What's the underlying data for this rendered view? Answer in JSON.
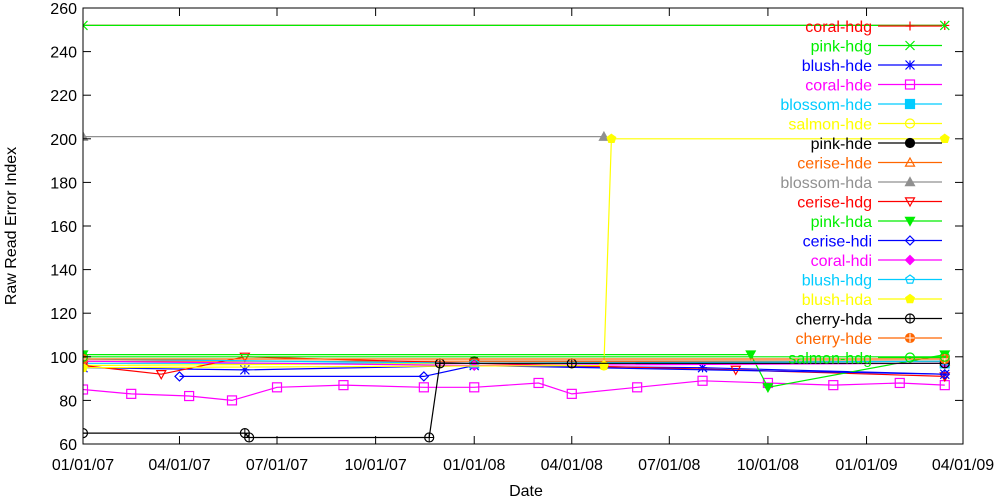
{
  "chart_data": {
    "type": "scatter",
    "title": "",
    "xlabel": "Date",
    "ylabel": "Raw Read Error Index",
    "ylim": [
      60,
      260
    ],
    "xlim": [
      "2007-01-01",
      "2009-04-01"
    ],
    "yticks": [
      60,
      80,
      100,
      120,
      140,
      160,
      180,
      200,
      220,
      240,
      260
    ],
    "xticks": [
      "01/01/07",
      "04/01/07",
      "07/01/07",
      "10/01/07",
      "01/01/08",
      "04/01/08",
      "07/01/08",
      "10/01/08",
      "01/01/09",
      "04/01/09"
    ],
    "xtick_dates": [
      "2007-01-01",
      "2007-04-01",
      "2007-07-01",
      "2007-10-01",
      "2008-01-01",
      "2008-04-01",
      "2008-07-01",
      "2008-10-01",
      "2009-01-01",
      "2009-04-01"
    ],
    "grid": false,
    "legend_position": "top-right",
    "series": [
      {
        "name": "coral-hdg",
        "color": "#ff0000",
        "marker": "plus",
        "x": [
          "2007-01-01",
          "2009-03-15"
        ],
        "y": [
          252,
          252
        ]
      },
      {
        "name": "pink-hdg",
        "color": "#00ee00",
        "marker": "x",
        "x": [
          "2007-01-01",
          "2009-03-15"
        ],
        "y": [
          252,
          252
        ]
      },
      {
        "name": "blush-hde",
        "color": "#0000ff",
        "marker": "star",
        "x": [
          "2007-01-01",
          "2007-06-01",
          "2008-01-01",
          "2008-08-01",
          "2009-03-15"
        ],
        "y": [
          95,
          94,
          96,
          95,
          92
        ]
      },
      {
        "name": "coral-hde",
        "color": "#ff00ff",
        "marker": "square-open",
        "x": [
          "2007-01-01",
          "2007-02-15",
          "2007-04-10",
          "2007-05-20",
          "2007-07-01",
          "2007-09-01",
          "2007-11-15",
          "2008-01-01",
          "2008-03-01",
          "2008-04-01",
          "2008-06-01",
          "2008-08-01",
          "2008-10-01",
          "2008-12-01",
          "2009-02-01",
          "2009-03-15"
        ],
        "y": [
          85,
          83,
          82,
          80,
          86,
          87,
          86,
          86,
          88,
          83,
          86,
          89,
          88,
          87,
          88,
          87
        ]
      },
      {
        "name": "blossom-hde",
        "color": "#00ccff",
        "marker": "square-filled",
        "x": [
          "2007-01-01",
          "2008-01-01",
          "2009-03-15"
        ],
        "y": [
          97,
          97,
          97
        ]
      },
      {
        "name": "salmon-hde",
        "color": "#ffff00",
        "marker": "circle-open",
        "x": [
          "2007-01-01",
          "2008-01-01",
          "2008-05-01"
        ],
        "y": [
          96,
          97,
          96
        ]
      },
      {
        "name": "pink-hde",
        "color": "#000000",
        "marker": "circle-filled",
        "x": [
          "2008-01-01",
          "2009-03-15"
        ],
        "y": [
          98,
          98
        ]
      },
      {
        "name": "cerise-hde",
        "color": "#ff6600",
        "marker": "triangle-open",
        "x": [
          "2007-01-01",
          "2009-03-15"
        ],
        "y": [
          98,
          98
        ]
      },
      {
        "name": "blossom-hda",
        "color": "#909090",
        "marker": "triangle-filled",
        "x": [
          "2007-01-01",
          "2008-05-01"
        ],
        "y": [
          201,
          201
        ]
      },
      {
        "name": "cerise-hdg",
        "color": "#ff0000",
        "marker": "triangle-down-open",
        "x": [
          "2007-01-01",
          "2007-03-15",
          "2007-06-01",
          "2008-01-01",
          "2008-09-01",
          "2009-03-15"
        ],
        "y": [
          96,
          92,
          100,
          97,
          94,
          91
        ]
      },
      {
        "name": "pink-hda",
        "color": "#00ee00",
        "marker": "triangle-down-filled",
        "x": [
          "2007-01-01",
          "2008-09-15",
          "2008-10-01",
          "2009-03-15"
        ],
        "y": [
          101,
          101,
          86,
          101
        ]
      },
      {
        "name": "cerise-hdi",
        "color": "#0000ff",
        "marker": "diamond-open",
        "x": [
          "2007-04-01",
          "2007-11-15",
          "2008-01-01",
          "2009-03-15"
        ],
        "y": [
          91,
          91,
          96,
          92
        ]
      },
      {
        "name": "coral-hdi",
        "color": "#ff00ff",
        "marker": "diamond-filled",
        "x": [
          "2007-01-01",
          "2008-01-01",
          "2009-03-15"
        ],
        "y": [
          98,
          96,
          97
        ]
      },
      {
        "name": "blush-hdg",
        "color": "#00ccff",
        "marker": "pentagon-open",
        "x": [
          "2007-01-01",
          "2008-01-01",
          "2009-03-15"
        ],
        "y": [
          99,
          97,
          98
        ]
      },
      {
        "name": "blush-hda",
        "color": "#ffff00",
        "marker": "pentagon-filled",
        "x": [
          "2007-01-01",
          "2008-05-01",
          "2008-05-08",
          "2009-03-15"
        ],
        "y": [
          95,
          96,
          200,
          200
        ]
      },
      {
        "name": "cherry-hda",
        "color": "#000000",
        "marker": "circle-cross-open",
        "x": [
          "2007-01-01",
          "2007-06-01",
          "2007-06-05",
          "2007-11-20",
          "2007-11-30",
          "2008-04-01",
          "2009-03-15"
        ],
        "y": [
          65,
          65,
          63,
          63,
          97,
          97,
          97
        ]
      },
      {
        "name": "cherry-hde",
        "color": "#ff6600",
        "marker": "circle-cross-filled",
        "x": [
          "2007-01-01",
          "2009-03-15"
        ],
        "y": [
          99,
          99
        ]
      },
      {
        "name": "salmon-hdg",
        "color": "#00ee00",
        "marker": "circle-dot-open",
        "x": [
          "2007-01-01",
          "2009-03-15"
        ],
        "y": [
          100,
          100
        ]
      }
    ]
  }
}
